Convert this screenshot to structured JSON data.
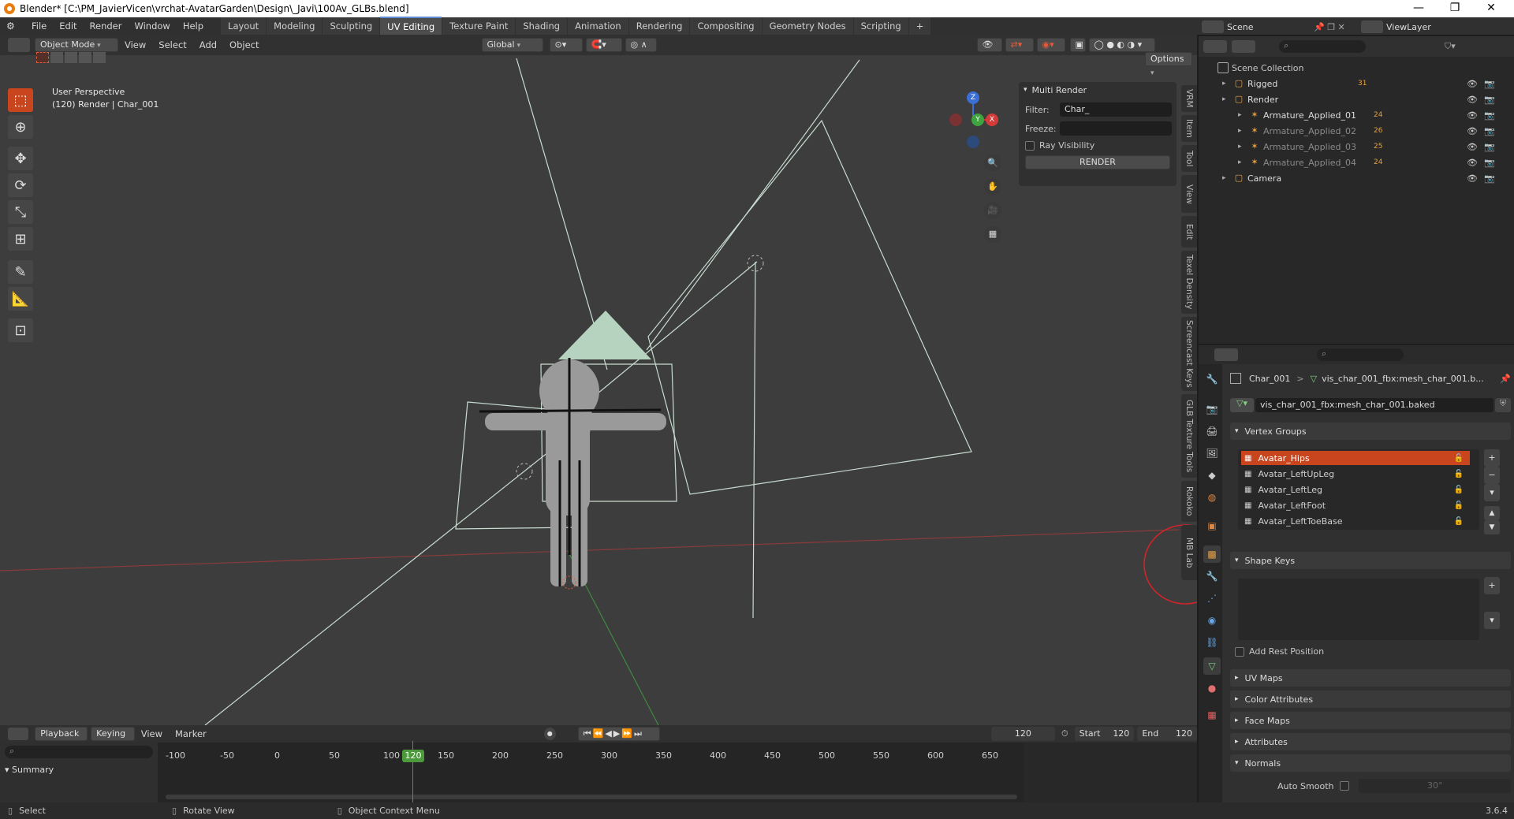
{
  "window": {
    "title": "Blender* [C:\\PM_JavierVicen\\vrchat-AvatarGarden\\Design\\_Javi\\100Av_GLBs.blend]",
    "minimize": "—",
    "maximize": "❐",
    "close": "✕"
  },
  "menu": {
    "items": [
      "File",
      "Edit",
      "Render",
      "Window",
      "Help"
    ],
    "workspaces": [
      "Layout",
      "Modeling",
      "Sculpting",
      "UV Editing",
      "Texture Paint",
      "Shading",
      "Animation",
      "Rendering",
      "Compositing",
      "Geometry Nodes",
      "Scripting"
    ],
    "active_workspace": "UV Editing",
    "add_tab": "+"
  },
  "top_right": {
    "scene": "Scene",
    "view_layer": "ViewLayer"
  },
  "viewport": {
    "mode": "Object Mode",
    "menu": [
      "View",
      "Select",
      "Add",
      "Object"
    ],
    "orientation": "Global",
    "options": "Options",
    "perspective_label": "User Perspective",
    "object_label": "(120) Render | Char_001",
    "gizmo_z": "Z",
    "gizmo_y": "Y",
    "gizmo_x": "X"
  },
  "multi_render": {
    "title": "Multi Render",
    "filter_label": "Filter:",
    "filter_value": "Char_",
    "freeze_label": "Freeze:",
    "freeze_value": "",
    "ray_visibility": "Ray Visibility",
    "render_button": "RENDER"
  },
  "n_tabs": [
    "VRM",
    "Item",
    "Tool",
    "View",
    "Edit",
    "Texel Density",
    "Screencast Keys",
    "GLB Texture Tools",
    "Rokoko",
    "MB Lab"
  ],
  "outliner": {
    "root": "Scene Collection",
    "rows": [
      {
        "name": "Rigged",
        "badge": "31",
        "indent": 1
      },
      {
        "name": "Render",
        "badge": "",
        "indent": 1
      },
      {
        "name": "Armature_Applied_01",
        "badge": "24",
        "indent": 2
      },
      {
        "name": "Armature_Applied_02",
        "badge": "26",
        "indent": 2
      },
      {
        "name": "Armature_Applied_03",
        "badge": "25",
        "indent": 2
      },
      {
        "name": "Armature_Applied_04",
        "badge": "24",
        "indent": 2
      },
      {
        "name": "Camera",
        "badge": "",
        "indent": 1
      }
    ]
  },
  "properties": {
    "breadcrumb_object": "Char_001",
    "breadcrumb_sep": ">",
    "breadcrumb_data": "vis_char_001_fbx:mesh_char_001.b...",
    "mesh_name": "vis_char_001_fbx:mesh_char_001.baked",
    "vertex_groups_title": "Vertex Groups",
    "vertex_groups": [
      "Avatar_Hips",
      "Avatar_LeftUpLeg",
      "Avatar_LeftLeg",
      "Avatar_LeftFoot",
      "Avatar_LeftToeBase"
    ],
    "shape_keys_title": "Shape Keys",
    "add_rest_position": "Add Rest Position",
    "collapsed_panels": [
      "UV Maps",
      "Color Attributes",
      "Face Maps",
      "Attributes"
    ],
    "normals_title": "Normals",
    "auto_smooth": "Auto Smooth",
    "auto_smooth_angle": "30°"
  },
  "timeline": {
    "menu": [
      "Playback",
      "Keying",
      "View",
      "Marker"
    ],
    "current_frame": "120",
    "start_label": "Start",
    "start_value": "120",
    "end_label": "End",
    "end_value": "120",
    "ticks": [
      "-100",
      "-50",
      "0",
      "50",
      "100",
      "150",
      "200",
      "250",
      "300",
      "350",
      "400",
      "450",
      "500",
      "550",
      "600",
      "650"
    ],
    "playhead": "120",
    "summary": "Summary"
  },
  "status": {
    "select": "Select",
    "rotate": "Rotate View",
    "context": "Object Context Menu",
    "version": "3.6.4"
  },
  "colors": {
    "accent": "#c8451e",
    "workspace_active": "#5b8ad6",
    "playhead": "#4d9a3c",
    "annotation_circle": "#d0242a"
  }
}
